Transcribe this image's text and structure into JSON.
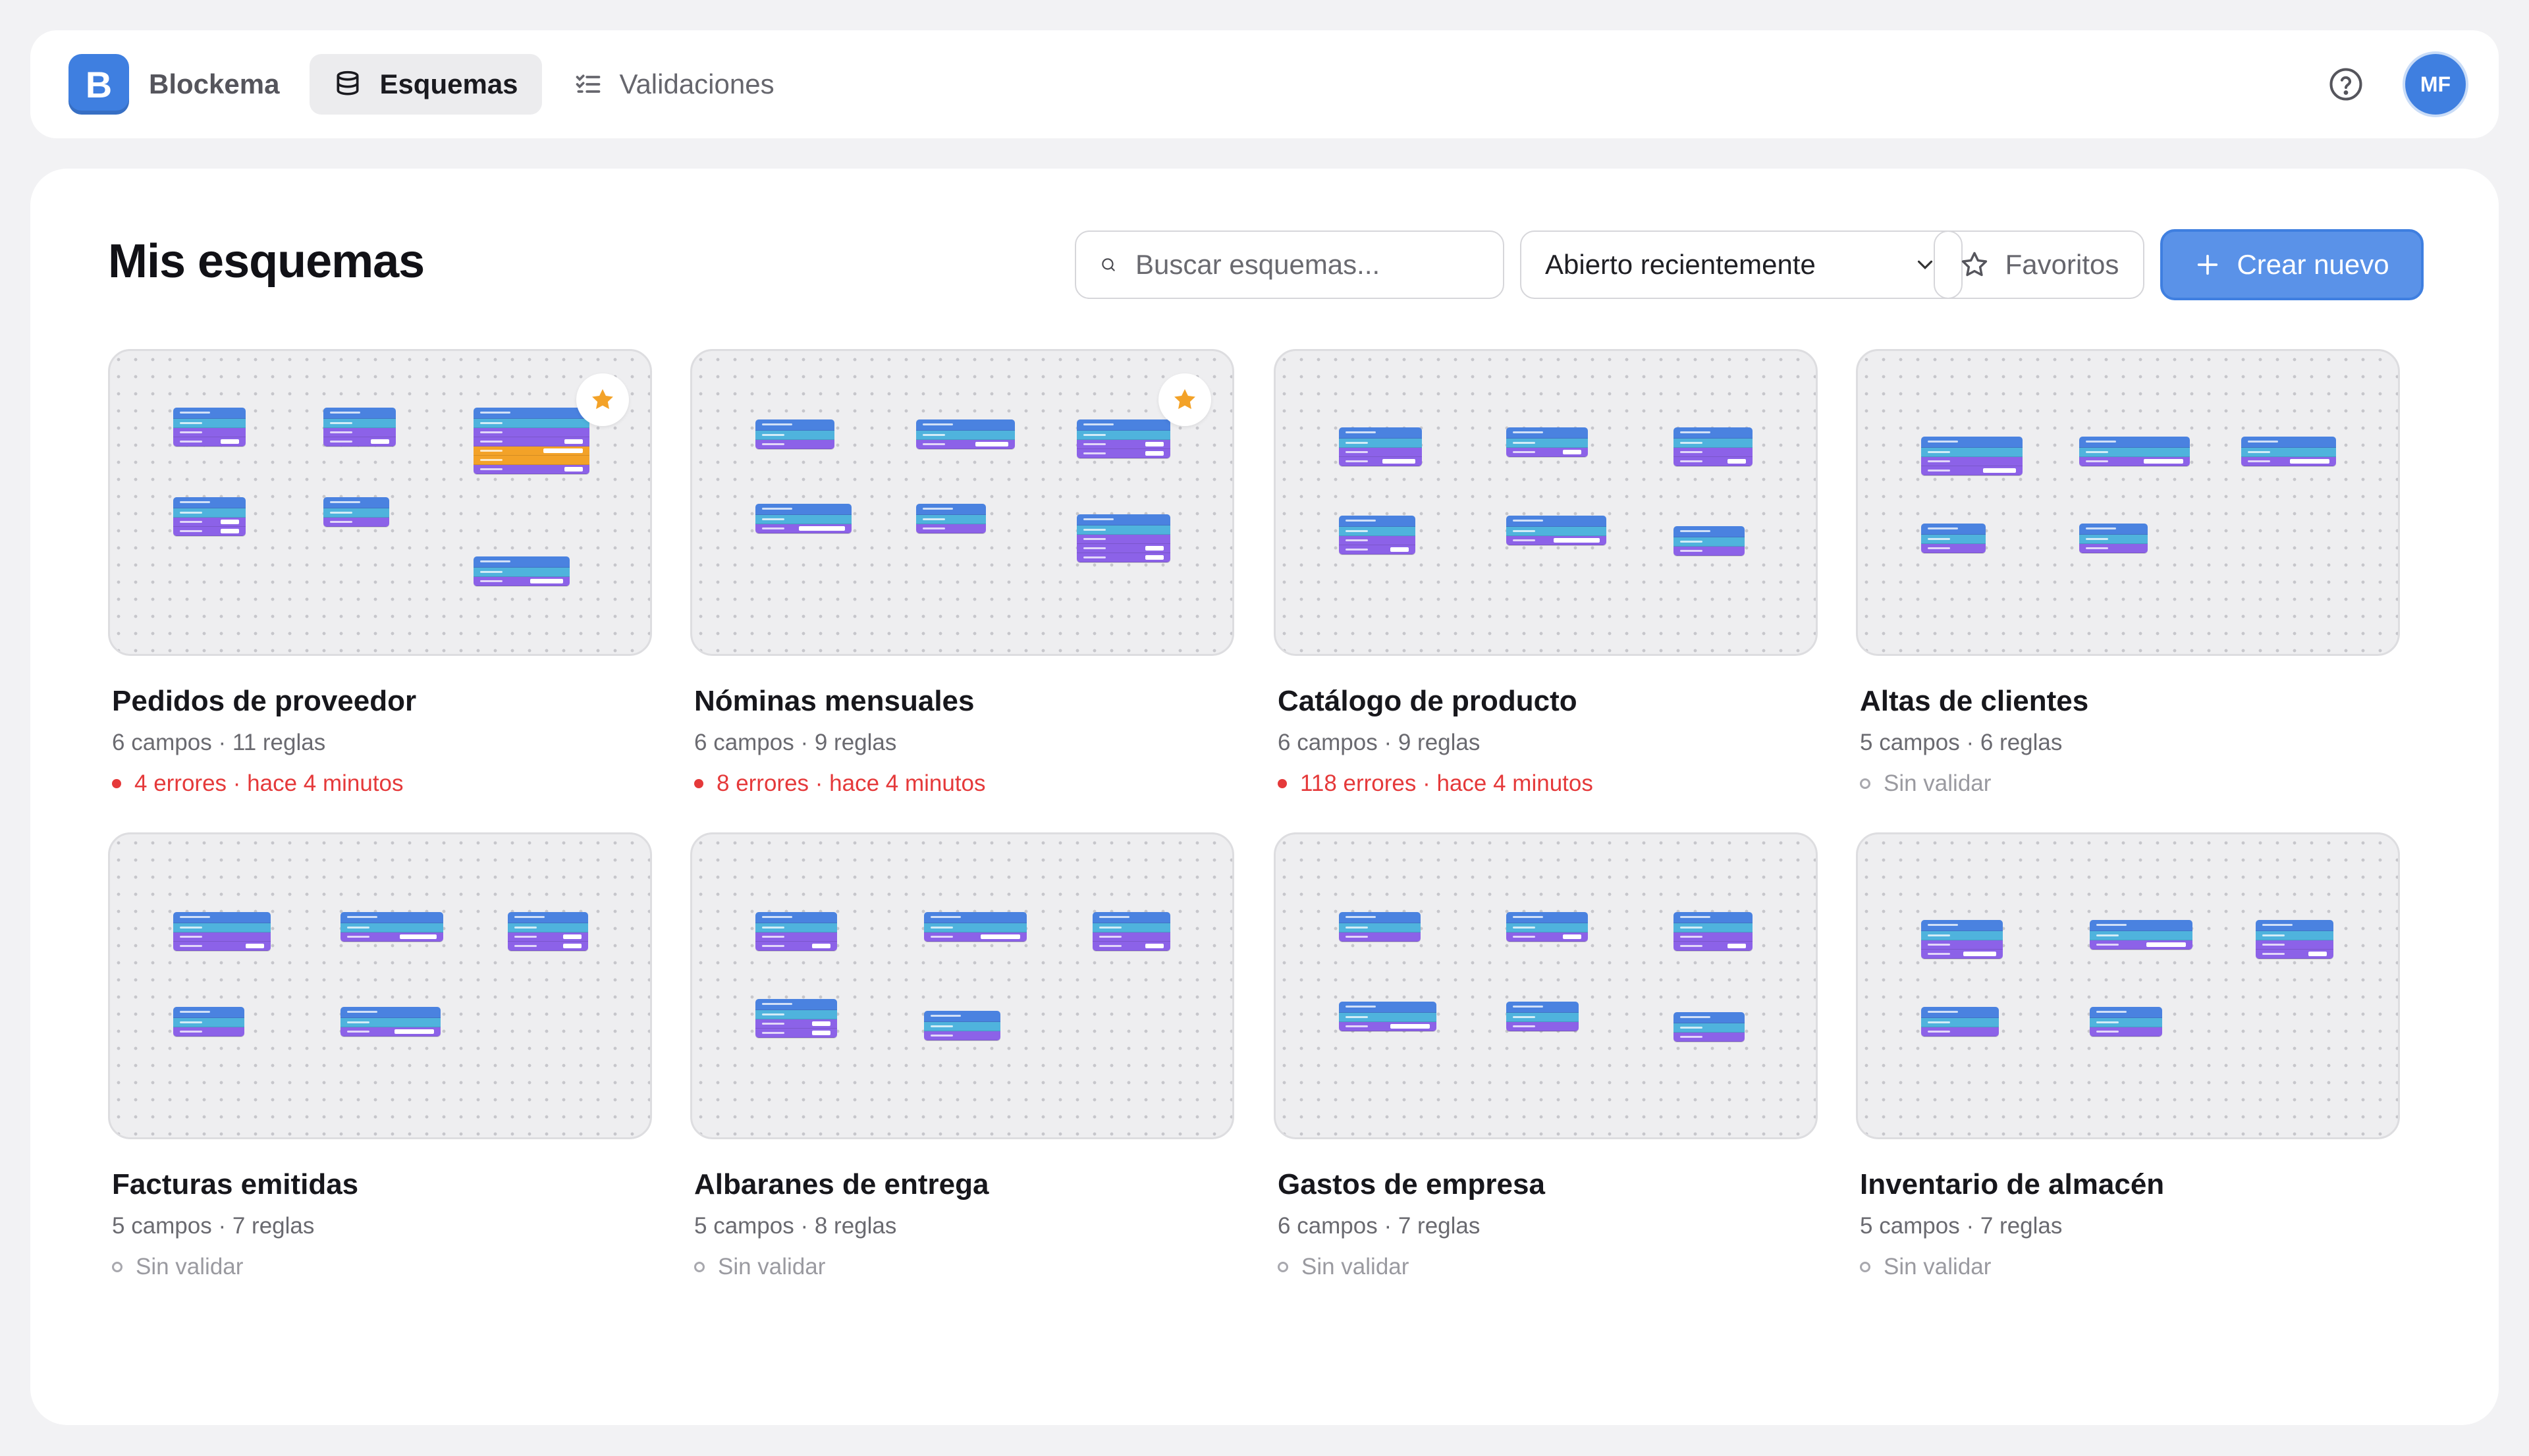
{
  "app": {
    "name": "Blockema",
    "logo_letter": "B",
    "nav": [
      {
        "label": "Esquemas",
        "icon": "database-icon",
        "active": true
      },
      {
        "label": "Validaciones",
        "icon": "checklist-icon",
        "active": false
      }
    ],
    "user_initials": "MF",
    "accent_color": "#3f7fe0",
    "error_color": "#e5393a"
  },
  "main": {
    "title": "Mis esquemas",
    "search_placeholder": "Buscar esquemas...",
    "sort_selected": "Abierto recientemente",
    "favorites_label": "Favoritos",
    "create_label": "Crear nuevo"
  },
  "schemas": [
    {
      "title": "Pedidos de proveedor",
      "meta": "6 campos · 11 reglas",
      "status": "4 errores · hace 4 minutos",
      "state": "error",
      "favorite": true
    },
    {
      "title": "Nóminas mensuales",
      "meta": "6 campos · 9 reglas",
      "status": "8 errores · hace 4 minutos",
      "state": "error",
      "favorite": true
    },
    {
      "title": "Catálogo de producto",
      "meta": "6 campos · 9 reglas",
      "status": "118 errores · hace 4 minutos",
      "state": "error",
      "favorite": false
    },
    {
      "title": "Altas de clientes",
      "meta": "5 campos · 6 reglas",
      "status": "Sin validar",
      "state": "none",
      "favorite": false
    },
    {
      "title": "Facturas emitidas",
      "meta": "5 campos · 7 reglas",
      "status": "Sin validar",
      "state": "none",
      "favorite": false
    },
    {
      "title": "Albaranes de entrega",
      "meta": "5 campos · 8 reglas",
      "status": "Sin validar",
      "state": "none",
      "favorite": false
    },
    {
      "title": "Gastos de empresa",
      "meta": "6 campos · 7 reglas",
      "status": "Sin validar",
      "state": "none",
      "favorite": false
    },
    {
      "title": "Inventario de almacén",
      "meta": "5 campos · 7 reglas",
      "status": "Sin validar",
      "state": "none",
      "favorite": false
    }
  ]
}
